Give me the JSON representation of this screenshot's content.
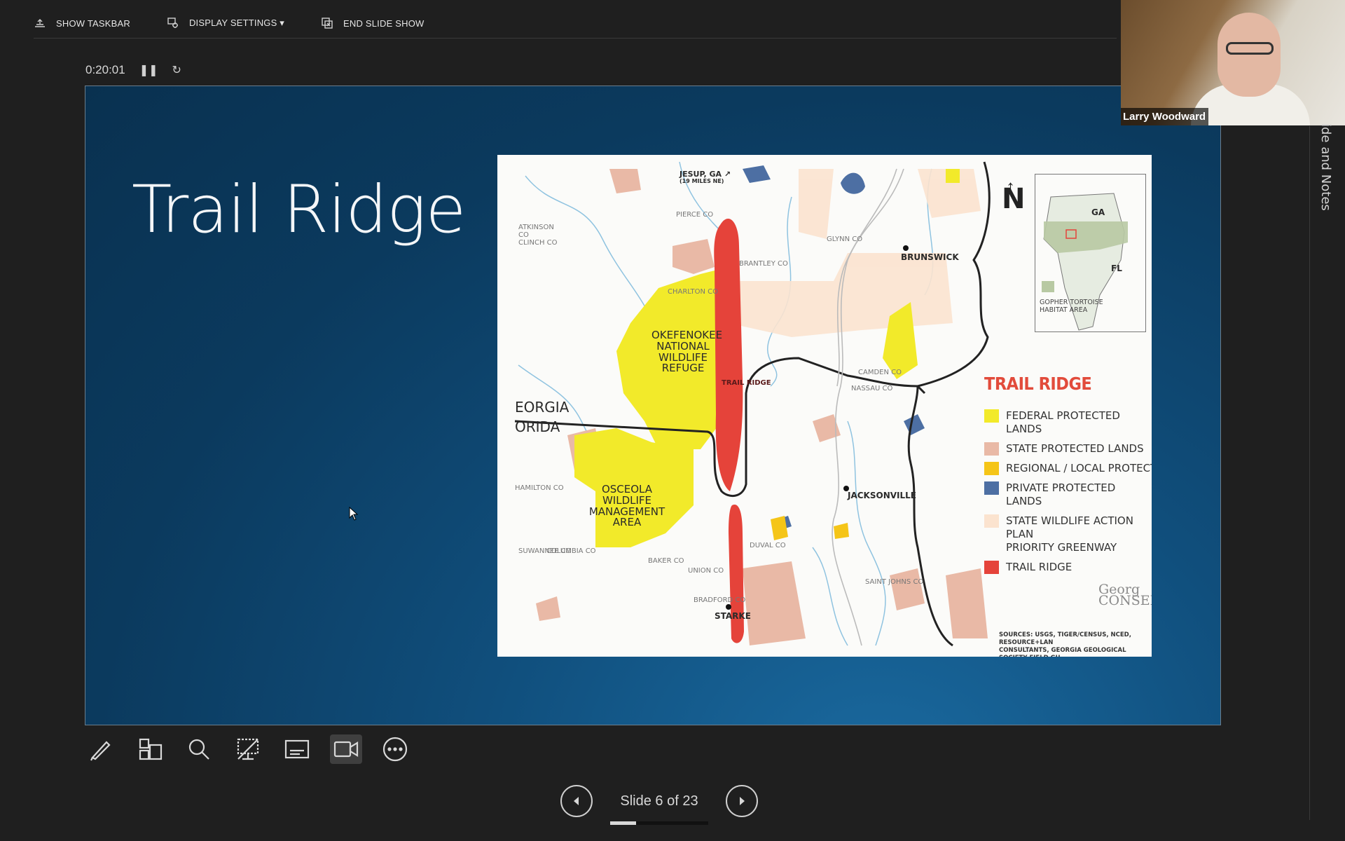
{
  "toolbar": {
    "show_taskbar": "SHOW TASKBAR",
    "display_settings": "DISPLAY SETTINGS ▾",
    "end_slide_show": "END SLIDE SHOW"
  },
  "timer": {
    "elapsed": "0:20:01"
  },
  "slide": {
    "title": "Trail Ridge",
    "map": {
      "labels": {
        "jesup": "JESUP, GA ↗",
        "jesup_sub": "(19 MILES NE)",
        "atkinson": "ATKINSON CO\nCLINCH CO",
        "brunswick": "BRUNSWICK",
        "okefenokee": "OKEFENOKEE\nNATIONAL\nWILDLIFE\nREFUGE",
        "osceola": "OSCEOLA\nWILDLIFE\nMANAGEMENT\nAREA",
        "jacksonville": "JACKSONVILLE",
        "starke": "STARKE",
        "georgia": "EORGIA",
        "florida": "ORIDA",
        "trail_ridge_vert": "TRAIL RIDGE",
        "charlton": "CHARLTON CO",
        "brantley": "BRANTLEY CO",
        "pierce": "PIERCE CO",
        "glynn": "GLYNN CO",
        "camden": "CAMDEN CO",
        "nassau": "NASSAU CO",
        "duval": "DUVAL CO",
        "baker": "BAKER CO",
        "union": "UNION CO",
        "bradford": "BRADFORD CO",
        "st_johns": "SAINT JOHNS CO",
        "hamilton": "HAMILTON CO",
        "suwannee": "SUWANNEE CO",
        "columbia": "COLUMBIA CO",
        "north": "N",
        "inset_ga": "GA",
        "inset_fl": "FL",
        "inset_legend": "GOPHER TORTOISE\nHABITAT AREA",
        "sources": "SOURCES: USGS, TIGER/CENSUS, NCED, RESOURCE+LAN\nCONSULTANTS, GEORGIA GEOLOGICAL SOCIETY FIELD GU",
        "conservancy": "Georg\nCONSERVA"
      },
      "legend": {
        "title": "TRAIL RIDGE",
        "items": [
          {
            "label": "FEDERAL PROTECTED LANDS",
            "color": "#f2ea2a"
          },
          {
            "label": "STATE PROTECTED LANDS",
            "color": "#e9b9a6"
          },
          {
            "label": "REGIONAL / LOCAL PROTECTED L",
            "color": "#f5c518"
          },
          {
            "label": "PRIVATE PROTECTED LANDS",
            "color": "#4d6fa3"
          },
          {
            "label": "STATE WILDLIFE ACTION PLAN\nPRIORITY GREENWAY",
            "color": "#fbe3cf"
          },
          {
            "label": "TRAIL RIDGE",
            "color": "#e5433a"
          }
        ]
      }
    }
  },
  "presenter": {
    "name": "Larry Woodward"
  },
  "side_panel": {
    "label": "ide and Notes"
  },
  "nav": {
    "slide_counter": "Slide 6 of 23",
    "current": 6,
    "total": 23
  }
}
